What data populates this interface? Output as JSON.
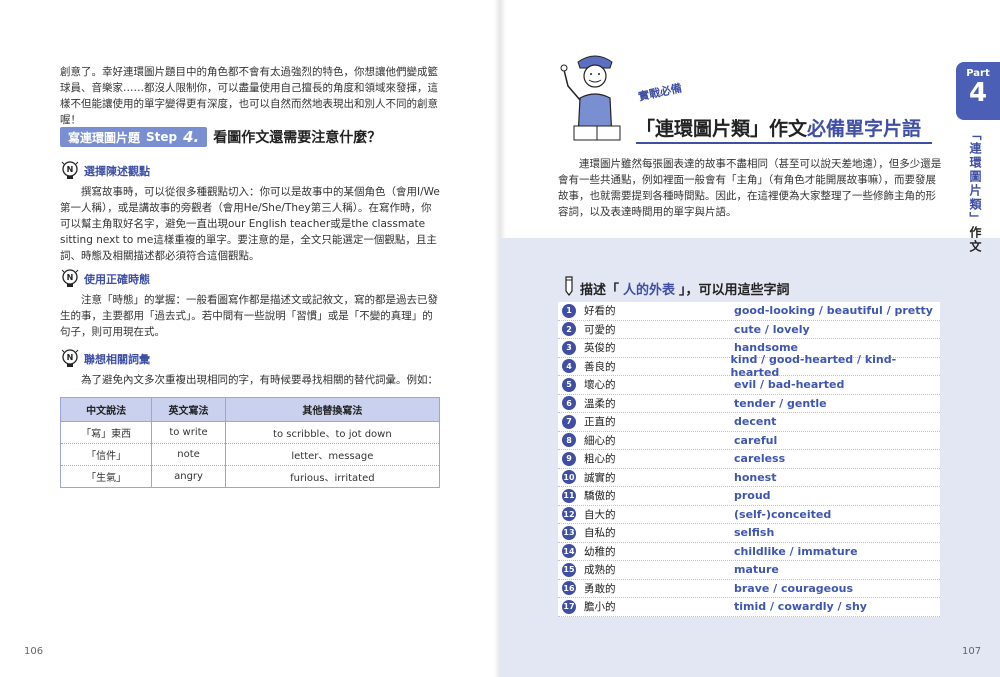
{
  "left": {
    "intro": "創意了。幸好連環圖片題目中的角色都不會有太過強烈的特色，你想讓他們變成籃球員、音樂家……都沒人限制你，可以盡量使用自己擅長的角度和領域來發揮，這樣不但能讓使用的單字變得更有深度，也可以自然而然地表現出和別人不同的創意喔！",
    "step_badge_text": "寫連環圖片題",
    "step_label": "Step",
    "step_num": "4.",
    "step_title": "看圖作文還需要注意什麼？",
    "tips": [
      {
        "title": "選擇陳述觀點",
        "body": "撰寫故事時，可以從很多種觀點切入：你可以是故事中的某個角色（會用I/We第一人稱），或是講故事的旁觀者（會用He/She/They第三人稱）。在寫作時，你可以幫主角取好名字，避免一直出現our English teacher或是the classmate sitting next to me這樣重複的單字。要注意的是，全文只能選定一個觀點，且主詞、時態及相關描述都必須符合這個觀點。"
      },
      {
        "title": "使用正確時態",
        "body": "注意「時態」的掌握：一般看圖寫作都是描述文或記敘文，寫的都是過去已發生的事，主要都用「過去式」。若中間有一些說明「習慣」或是「不變的真理」的句子，則可用現在式。"
      },
      {
        "title": "聯想相關詞彙",
        "body": "為了避免內文多次重複出現相同的字，有時候要尋找相關的替代詞彙。例如："
      }
    ],
    "table": {
      "headers": [
        "中文說法",
        "英文寫法",
        "其他替換寫法"
      ],
      "rows": [
        [
          "「寫」東西",
          "to write",
          "to scribble、to jot down"
        ],
        [
          "「信件」",
          "note",
          "letter、message"
        ],
        [
          "「生氣」",
          "angry",
          "furious、irritated"
        ]
      ]
    },
    "page_number": "106"
  },
  "right": {
    "sub_badge": "實戰必備",
    "title_part1": "「連環圖片類」作文",
    "title_part2": "必備單字片語",
    "intro": "連環圖片雖然每張圖表達的故事不盡相同（甚至可以說天差地遠），但多少還是會有一些共通點，例如裡面一般會有「主角」（有角色才能開展故事嘛），而要發展故事，也就需要提到各種時間點。因此，在這裡便為大家整理了一些修飾主角的形容詞，以及表達時間用的單字與片語。",
    "tab_part": "Part",
    "tab_num": "4",
    "vertical_title_hl": "「連環圖片類」",
    "vertical_title_rest": "作文",
    "vocab_heading_pre": "描述「",
    "vocab_heading_hl": "人的外表",
    "vocab_heading_post": "」，可以用這些字詞",
    "vocab": [
      {
        "n": "1",
        "zh": "好看的",
        "en": "good-looking / beautiful / pretty"
      },
      {
        "n": "2",
        "zh": "可愛的",
        "en": "cute / lovely"
      },
      {
        "n": "3",
        "zh": "英俊的",
        "en": "handsome"
      },
      {
        "n": "4",
        "zh": "善良的",
        "en": "kind / good-hearted / kind-hearted"
      },
      {
        "n": "5",
        "zh": "壞心的",
        "en": "evil / bad-hearted"
      },
      {
        "n": "6",
        "zh": "溫柔的",
        "en": "tender / gentle"
      },
      {
        "n": "7",
        "zh": "正直的",
        "en": "decent"
      },
      {
        "n": "8",
        "zh": "細心的",
        "en": "careful"
      },
      {
        "n": "9",
        "zh": "粗心的",
        "en": "careless"
      },
      {
        "n": "10",
        "zh": "誠實的",
        "en": "honest"
      },
      {
        "n": "11",
        "zh": "驕傲的",
        "en": "proud"
      },
      {
        "n": "12",
        "zh": "自大的",
        "en": "(self-)conceited"
      },
      {
        "n": "13",
        "zh": "自私的",
        "en": "selfish"
      },
      {
        "n": "14",
        "zh": "幼稚的",
        "en": "childlike / immature"
      },
      {
        "n": "15",
        "zh": "成熟的",
        "en": "mature"
      },
      {
        "n": "16",
        "zh": "勇敢的",
        "en": "brave / courageous"
      },
      {
        "n": "17",
        "zh": "膽小的",
        "en": "timid / cowardly / shy"
      }
    ],
    "page_number": "107"
  },
  "colors": {
    "accent": "#3f4fa3",
    "badge": "#7a8fd1",
    "table_header": "#c9d1ee",
    "panel": "#e3e6f3",
    "tab": "#4a5fb5"
  }
}
